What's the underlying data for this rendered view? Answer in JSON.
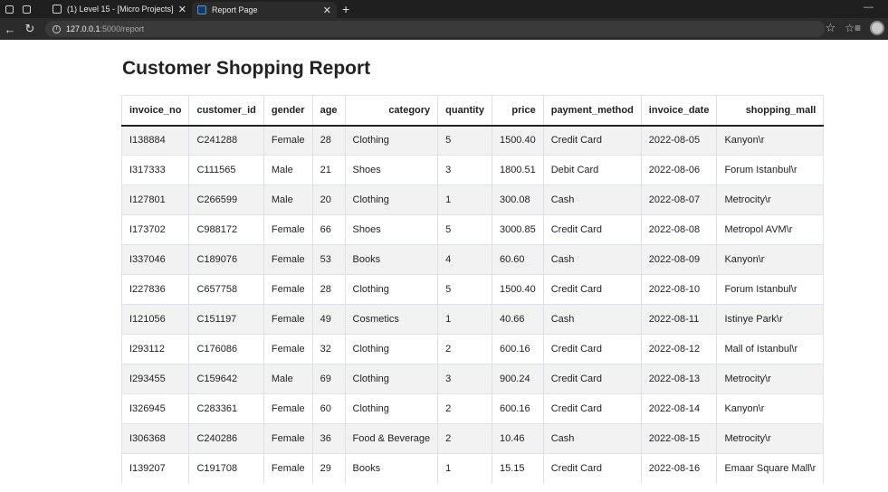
{
  "browser": {
    "tabs": [
      {
        "title": "(1) Level 15 - [Micro Projects]",
        "active": false
      },
      {
        "title": "Report Page",
        "active": true
      }
    ],
    "url_host": "127.0.0.1",
    "url_path": ":5000/report"
  },
  "report": {
    "title": "Customer Shopping Report",
    "columns": [
      "invoice_no",
      "customer_id",
      "gender",
      "age",
      "category",
      "quantity",
      "price",
      "payment_method",
      "invoice_date",
      "shopping_mall"
    ],
    "rows": [
      [
        "I138884",
        "C241288",
        "Female",
        "28",
        "Clothing",
        "5",
        "1500.40",
        "Credit Card",
        "2022-08-05",
        "Kanyon\\r"
      ],
      [
        "I317333",
        "C111565",
        "Male",
        "21",
        "Shoes",
        "3",
        "1800.51",
        "Debit Card",
        "2022-08-06",
        "Forum Istanbul\\r"
      ],
      [
        "I127801",
        "C266599",
        "Male",
        "20",
        "Clothing",
        "1",
        "300.08",
        "Cash",
        "2022-08-07",
        "Metrocity\\r"
      ],
      [
        "I173702",
        "C988172",
        "Female",
        "66",
        "Shoes",
        "5",
        "3000.85",
        "Credit Card",
        "2022-08-08",
        "Metropol AVM\\r"
      ],
      [
        "I337046",
        "C189076",
        "Female",
        "53",
        "Books",
        "4",
        "60.60",
        "Cash",
        "2022-08-09",
        "Kanyon\\r"
      ],
      [
        "I227836",
        "C657758",
        "Female",
        "28",
        "Clothing",
        "5",
        "1500.40",
        "Credit Card",
        "2022-08-10",
        "Forum Istanbul\\r"
      ],
      [
        "I121056",
        "C151197",
        "Female",
        "49",
        "Cosmetics",
        "1",
        "40.66",
        "Cash",
        "2022-08-11",
        "Istinye Park\\r"
      ],
      [
        "I293112",
        "C176086",
        "Female",
        "32",
        "Clothing",
        "2",
        "600.16",
        "Credit Card",
        "2022-08-12",
        "Mall of Istanbul\\r"
      ],
      [
        "I293455",
        "C159642",
        "Male",
        "69",
        "Clothing",
        "3",
        "900.24",
        "Credit Card",
        "2022-08-13",
        "Metrocity\\r"
      ],
      [
        "I326945",
        "C283361",
        "Female",
        "60",
        "Clothing",
        "2",
        "600.16",
        "Credit Card",
        "2022-08-14",
        "Kanyon\\r"
      ],
      [
        "I306368",
        "C240286",
        "Female",
        "36",
        "Food & Beverage",
        "2",
        "10.46",
        "Cash",
        "2022-08-15",
        "Metrocity\\r"
      ],
      [
        "I139207",
        "C191708",
        "Female",
        "29",
        "Books",
        "1",
        "15.15",
        "Credit Card",
        "2022-08-16",
        "Emaar Square Mall\\r"
      ]
    ]
  }
}
